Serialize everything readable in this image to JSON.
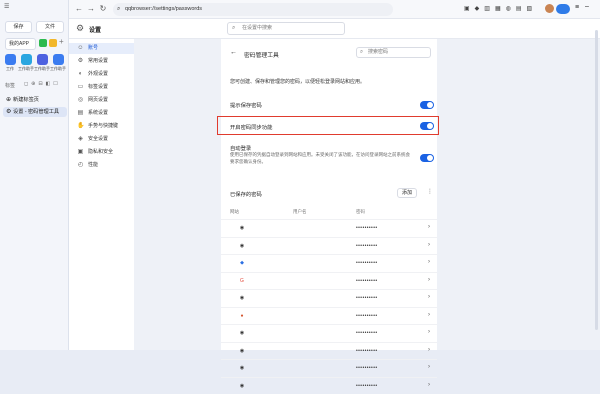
{
  "left_panel": {
    "btn_save": "保存",
    "btn_files": "文件",
    "my_app": "我的APP",
    "tiles": [
      {
        "label": "工作",
        "color": "#3b7cf0"
      },
      {
        "label": "工作助手",
        "color": "#2aa6e0"
      },
      {
        "label": "工作助手",
        "color": "#4e62e0"
      },
      {
        "label": "工作助手",
        "color": "#3b7cf0"
      }
    ],
    "tab_section_label": "标签",
    "new_tab_item": "新建标签页",
    "settings_tab_item": "设置 - 密码管理工具"
  },
  "browser": {
    "url": "qqbrowser://settings/passwords",
    "page_title": "设置"
  },
  "settings": {
    "search_placeholder": "在设置中搜索",
    "nav": [
      {
        "label": "账号",
        "icon": "user-icon",
        "active": true
      },
      {
        "label": "常用设置",
        "icon": "gear-icon",
        "active": false
      },
      {
        "label": "外观设置",
        "icon": "palette-icon",
        "active": false
      },
      {
        "label": "标签设置",
        "icon": "tab-icon",
        "active": false
      },
      {
        "label": "网页设置",
        "icon": "web-icon",
        "active": false
      },
      {
        "label": "系统设置",
        "icon": "system-icon",
        "active": false
      },
      {
        "label": "手势与快捷键",
        "icon": "hand-icon",
        "active": false
      },
      {
        "label": "安全设置",
        "icon": "shield-icon",
        "active": false
      },
      {
        "label": "隐私和安全",
        "icon": "lock-icon",
        "active": false
      },
      {
        "label": "性能",
        "icon": "performance-icon",
        "active": false
      }
    ],
    "password_manager": {
      "title": "密码管理工具",
      "search_placeholder": "搜索密码",
      "description": "您可创建、保存和管理您的密码，以便轻松登录网站和应用。",
      "offer_save": "提示保存密码",
      "enable_sync": "开启密码同步功能",
      "auto_signin": "自动登录",
      "auto_signin_desc": "使用已保存的凭据自动登录到网站和应用。未受关闭了该功能，在访问登录网站之前系统会要求您确认身份。",
      "saved_passwords": "已保存的密码",
      "add_button": "添加",
      "more_button": "⋮",
      "columns": [
        "网站",
        "用户名",
        "密码"
      ],
      "rows": [
        {
          "icon": "globe-icon",
          "glyph": "◉",
          "color": "#333",
          "password": "••••••••••"
        },
        {
          "icon": "globe-icon",
          "glyph": "◉",
          "color": "#333",
          "password": "••••••••••"
        },
        {
          "icon": "diamond-icon",
          "glyph": "◆",
          "color": "#2b6fe3",
          "password": "••••••••••"
        },
        {
          "icon": "google-icon",
          "glyph": "G",
          "color": "#e24a3b",
          "password": "••••••••••"
        },
        {
          "icon": "globe-icon",
          "glyph": "◉",
          "color": "#333",
          "password": "••••••••••"
        },
        {
          "icon": "avatar-icon",
          "glyph": "●",
          "color": "#d4552f",
          "password": "••••••••••"
        },
        {
          "icon": "globe-icon",
          "glyph": "◉",
          "color": "#333",
          "password": "••••••••••"
        },
        {
          "icon": "globe-icon",
          "glyph": "◉",
          "color": "#333",
          "password": "••••••••••"
        },
        {
          "icon": "globe-icon",
          "glyph": "◉",
          "color": "#333",
          "password": "••••••••••"
        },
        {
          "icon": "globe-icon",
          "glyph": "◉",
          "color": "#333",
          "password": "••••••••••"
        }
      ]
    }
  }
}
